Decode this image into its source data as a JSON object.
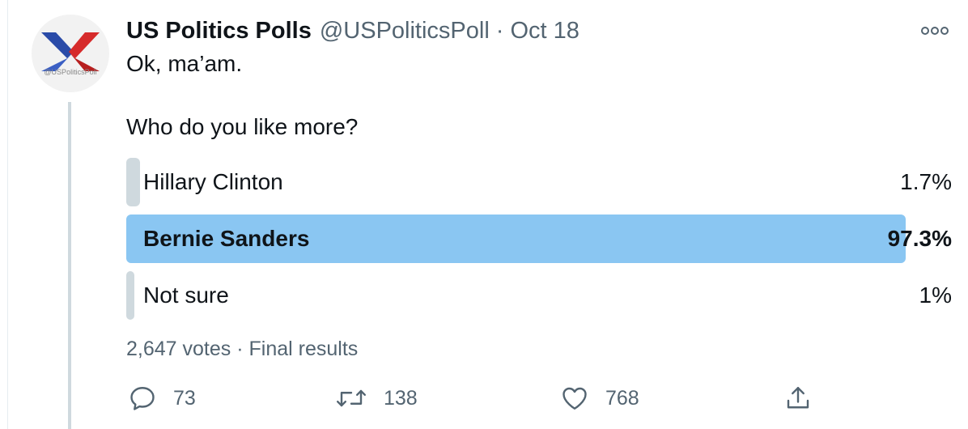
{
  "tweet": {
    "display_name": "US Politics Polls",
    "handle": "@USPoliticsPoll",
    "separator": "·",
    "date": "Oct 18",
    "avatar_handle_text": "@USPoliticsPoll",
    "line1": "Ok, ma’am.",
    "line2": "Who do you like more?"
  },
  "poll": {
    "options": [
      {
        "label": "Hillary Clinton",
        "percent": "1.7%",
        "value": 1.7,
        "winner": false
      },
      {
        "label": "Bernie Sanders",
        "percent": "97.3%",
        "value": 97.3,
        "winner": true
      },
      {
        "label": "Not sure",
        "percent": "1%",
        "value": 1,
        "winner": false
      }
    ],
    "votes": "2,647 votes",
    "status": "Final results",
    "separator": "·"
  },
  "actions": {
    "replies": "73",
    "retweets": "138",
    "likes": "768"
  },
  "icons": {
    "reply": "reply-icon",
    "retweet": "retweet-icon",
    "like": "heart-icon",
    "share": "share-icon",
    "more": "more-icon"
  },
  "colors": {
    "winner_bar": "#8ac6f2",
    "other_bar": "#cfd9de",
    "secondary_text": "#536471",
    "logo_blue": "#2a4ba8",
    "logo_red": "#d62b2b"
  }
}
